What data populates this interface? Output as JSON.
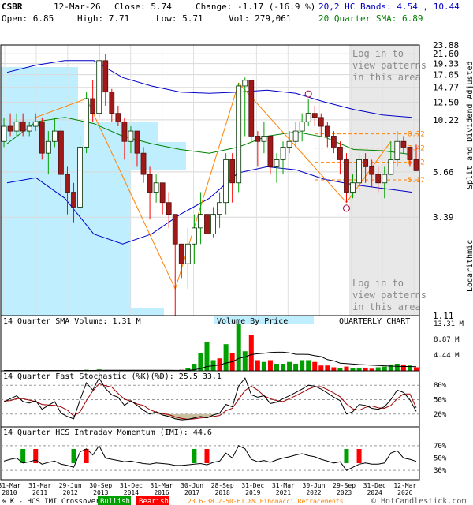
{
  "header": {
    "symbol": "CSBR",
    "date": "12-Mar-26",
    "close": "Close: 5.74",
    "change": "Change: -1.17 (-16.9 %)",
    "open": "Open: 6.85",
    "high": "High: 7.71",
    "low": "Low: 5.71",
    "vol": "Vol: 279,061",
    "bands": "20,2 HC Bands: 4.54 , 10.44",
    "sma": "20 Quarter SMA: 6.89"
  },
  "colors": {
    "up": "#00a000",
    "down": "#ff0000",
    "band": "#0000c8",
    "sma": "#008000",
    "vbp": "#bfefff",
    "stoch_k": "#000000",
    "stoch_d": "#a00000",
    "fib": "#ff8000",
    "shade": "#e8e8e8"
  },
  "price_panel": {
    "watermark": "Log in to\nview patterns\nin this area",
    "side_label_1": "Split and Dividend Adjusted",
    "side_label_2": "Logarithmic",
    "y_ticks": [
      "23.88",
      "21.60",
      "19.33",
      "17.05",
      "14.77",
      "12.50",
      "10.22",
      "5.66",
      "3.39",
      "1.11"
    ],
    "fib_labels": [
      "8.72",
      "7.42",
      "6.32",
      "5.17"
    ]
  },
  "volume_panel": {
    "title": "14 Quarter SMA Volume: 1.31 M",
    "vbp_label": "Volume By Price",
    "chart_label": "QUARTERLY CHART",
    "y_ticks": [
      "13.31 M",
      "8.87 M",
      "4.44 M"
    ]
  },
  "stoch_panel": {
    "title": "14 Quarter Fast Stochastic (%K)(%D): 25.5  33.1",
    "y_ticks": [
      "80%",
      "50%",
      "20%"
    ]
  },
  "imi_panel": {
    "title": "14 Quarter HCS Intraday Momentum (IMI): 44.6",
    "y_ticks": [
      "70%",
      "50%",
      "30%"
    ]
  },
  "x_labels": [
    [
      "31-Mar",
      "2010"
    ],
    [
      "31-Mar",
      "2011"
    ],
    [
      "29-Jun",
      "2012"
    ],
    [
      "30-Sep",
      "2013"
    ],
    [
      "31-Dec",
      "2014"
    ],
    [
      "31-Mar",
      "2016"
    ],
    [
      "30-Jun",
      "2017"
    ],
    [
      "28-Sep",
      "2018"
    ],
    [
      "31-Dec",
      "2019"
    ],
    [
      "31-Mar",
      "2021"
    ],
    [
      "30-Jun",
      "2022"
    ],
    [
      "29-Sep",
      "2023"
    ],
    [
      "31-Dec",
      "2024"
    ],
    [
      "12-Mar",
      "2026"
    ]
  ],
  "footer": {
    "legend_prefix": "% K - HCS IMI Crossover,",
    "bullish": "Bullish",
    "bearish": "Bearish",
    "fib": "23.6-38.2-50-61.8% Fibonacci Retracements",
    "copyright": "© HotCandlestick.com"
  },
  "chart_data": {
    "type": "candlestick",
    "y_scale": "log",
    "ylim": [
      1.11,
      23.88
    ],
    "candles": [
      [
        8.0,
        9.5,
        10.5,
        7.5
      ],
      [
        9.5,
        9.0,
        11.0,
        8.5
      ],
      [
        9.0,
        10.0,
        11.0,
        8.5
      ],
      [
        10.0,
        9.0,
        11.0,
        8.5
      ],
      [
        9.0,
        9.5,
        10.0,
        8.5
      ],
      [
        9.5,
        10.0,
        11.0,
        9.0
      ],
      [
        10.0,
        7.0,
        10.5,
        6.5
      ],
      [
        7.0,
        8.0,
        9.0,
        5.5
      ],
      [
        8.0,
        9.0,
        10.5,
        7.5
      ],
      [
        9.0,
        5.5,
        9.5,
        4.5
      ],
      [
        5.5,
        4.5,
        6.0,
        3.5
      ],
      [
        4.5,
        3.8,
        5.0,
        3.2
      ],
      [
        3.8,
        7.5,
        8.5,
        3.5
      ],
      [
        7.5,
        13.0,
        14.0,
        7.0
      ],
      [
        13.0,
        11.0,
        16.0,
        10.0
      ],
      [
        11.0,
        20.0,
        23.8,
        10.5
      ],
      [
        20.0,
        14.0,
        21.6,
        12.0
      ],
      [
        14.0,
        11.0,
        14.5,
        10.0
      ],
      [
        11.0,
        10.0,
        12.0,
        9.5
      ],
      [
        10.0,
        8.0,
        10.5,
        6.5
      ],
      [
        8.0,
        9.0,
        9.5,
        7.0
      ],
      [
        9.0,
        7.0,
        9.0,
        6.0
      ],
      [
        7.0,
        5.5,
        7.5,
        5.0
      ],
      [
        5.5,
        4.5,
        6.0,
        3.3
      ],
      [
        4.5,
        5.0,
        5.5,
        4.0
      ],
      [
        5.0,
        4.0,
        5.0,
        3.5
      ],
      [
        4.0,
        3.5,
        4.5,
        3.0
      ],
      [
        3.5,
        2.5,
        3.5,
        1.11
      ],
      [
        2.5,
        2.0,
        2.5,
        1.7
      ],
      [
        2.0,
        2.5,
        3.0,
        1.5
      ],
      [
        2.5,
        3.0,
        3.5,
        2.0
      ],
      [
        3.0,
        3.5,
        4.5,
        2.5
      ],
      [
        3.5,
        2.8,
        3.5,
        2.5
      ],
      [
        2.8,
        3.5,
        3.8,
        2.7
      ],
      [
        3.5,
        4.0,
        4.5,
        3.0
      ],
      [
        4.0,
        6.5,
        7.0,
        3.5
      ],
      [
        6.5,
        5.0,
        7.0,
        4.0
      ],
      [
        5.0,
        15.0,
        15.5,
        4.5
      ],
      [
        15.0,
        16.0,
        16.5,
        8.5
      ],
      [
        16.0,
        8.5,
        16.0,
        8.0
      ],
      [
        8.5,
        8.0,
        9.0,
        6.0
      ],
      [
        8.0,
        8.5,
        10.0,
        7.0
      ],
      [
        8.5,
        6.0,
        8.5,
        5.5
      ],
      [
        6.0,
        6.5,
        7.0,
        5.0
      ],
      [
        6.5,
        7.5,
        8.0,
        5.5
      ],
      [
        7.5,
        8.0,
        9.0,
        7.0
      ],
      [
        8.0,
        9.0,
        10.0,
        7.5
      ],
      [
        9.0,
        10.0,
        11.0,
        8.0
      ],
      [
        10.0,
        11.0,
        13.0,
        9.5
      ],
      [
        11.0,
        10.5,
        12.0,
        9.5
      ],
      [
        10.5,
        9.5,
        11.0,
        8.5
      ],
      [
        9.5,
        8.5,
        10.0,
        7.5
      ],
      [
        8.5,
        7.5,
        9.0,
        7.0
      ],
      [
        7.5,
        6.5,
        8.0,
        5.5
      ],
      [
        6.5,
        4.5,
        7.0,
        4.0
      ],
      [
        4.5,
        5.0,
        5.5,
        4.2
      ],
      [
        5.0,
        6.5,
        7.0,
        4.5
      ],
      [
        6.5,
        6.0,
        7.0,
        5.0
      ],
      [
        6.0,
        5.5,
        6.5,
        4.8
      ],
      [
        5.5,
        5.0,
        6.0,
        4.5
      ],
      [
        5.0,
        5.5,
        6.0,
        4.2
      ],
      [
        5.5,
        6.5,
        8.0,
        5.5
      ],
      [
        6.5,
        8.0,
        9.0,
        6.0
      ],
      [
        8.0,
        7.5,
        8.5,
        7.0
      ],
      [
        7.5,
        6.5,
        7.5,
        6.0
      ],
      [
        6.5,
        5.74,
        7.71,
        5.71
      ]
    ],
    "bands": {
      "upper": [
        17.5,
        19.0,
        20.0,
        20.0,
        16.5,
        15.0,
        14.0,
        13.8,
        14.0,
        14.3,
        13.8,
        12.5,
        11.5,
        10.8,
        10.5
      ],
      "sma": [
        7.8,
        10.0,
        10.5,
        9.8,
        8.5,
        7.8,
        7.3,
        7.0,
        7.5,
        8.5,
        8.9,
        8.4,
        7.3,
        7.2,
        6.9
      ],
      "lower": [
        5.0,
        5.3,
        4.2,
        2.8,
        2.5,
        2.8,
        3.5,
        4.2,
        5.6,
        6.0,
        5.8,
        5.2,
        4.9,
        4.7,
        4.5
      ]
    },
    "fib_levels": [
      8.72,
      7.42,
      6.32,
      5.17
    ],
    "volume": [
      [
        0.1,
        1
      ],
      [
        0.1,
        0
      ],
      [
        0.1,
        1
      ],
      [
        0.1,
        0
      ],
      [
        0.1,
        1
      ],
      [
        0.1,
        0
      ],
      [
        0.1,
        0
      ],
      [
        0.1,
        1
      ],
      [
        0.1,
        0
      ],
      [
        0.1,
        0
      ],
      [
        0.1,
        0
      ],
      [
        0.1,
        0
      ],
      [
        0.1,
        1
      ],
      [
        0.3,
        1
      ],
      [
        0.2,
        0
      ],
      [
        0.4,
        1
      ],
      [
        0.2,
        0
      ],
      [
        0.1,
        0
      ],
      [
        0.1,
        0
      ],
      [
        0.1,
        0
      ],
      [
        0.1,
        1
      ],
      [
        0.1,
        0
      ],
      [
        0.1,
        0
      ],
      [
        0.1,
        0
      ],
      [
        0.1,
        1
      ],
      [
        0.1,
        0
      ],
      [
        0.1,
        0
      ],
      [
        0.1,
        0
      ],
      [
        0.3,
        0
      ],
      [
        0.8,
        1
      ],
      [
        2.0,
        1
      ],
      [
        5.0,
        1
      ],
      [
        8.0,
        1
      ],
      [
        3.0,
        1
      ],
      [
        3.5,
        0
      ],
      [
        7.5,
        1
      ],
      [
        5.0,
        0
      ],
      [
        13.31,
        1
      ],
      [
        5.5,
        1
      ],
      [
        10.0,
        0
      ],
      [
        3.0,
        0
      ],
      [
        2.5,
        1
      ],
      [
        3.0,
        0
      ],
      [
        2.0,
        1
      ],
      [
        2.0,
        1
      ],
      [
        2.5,
        1
      ],
      [
        2.0,
        1
      ],
      [
        3.0,
        1
      ],
      [
        3.0,
        1
      ],
      [
        2.5,
        0
      ],
      [
        1.5,
        0
      ],
      [
        1.5,
        0
      ],
      [
        1.0,
        0
      ],
      [
        0.8,
        1
      ],
      [
        1.2,
        0
      ],
      [
        0.8,
        1
      ],
      [
        0.9,
        1
      ],
      [
        0.9,
        0
      ],
      [
        0.6,
        0
      ],
      [
        1.0,
        1
      ],
      [
        1.2,
        1
      ],
      [
        1.8,
        1
      ],
      [
        2.0,
        1
      ],
      [
        1.8,
        0
      ],
      [
        1.5,
        1
      ],
      [
        1.0,
        0
      ]
    ],
    "stoch_k": [
      45,
      52,
      58,
      46,
      43,
      48,
      30,
      38,
      46,
      22,
      15,
      10,
      50,
      85,
      70,
      95,
      73,
      60,
      55,
      38,
      48,
      38,
      28,
      20,
      25,
      18,
      15,
      10,
      8,
      9,
      12,
      15,
      12,
      18,
      22,
      40,
      35,
      78,
      95,
      60,
      55,
      58,
      42,
      45,
      52,
      58,
      65,
      72,
      80,
      78,
      72,
      64,
      55,
      48,
      20,
      25,
      40,
      38,
      32,
      30,
      35,
      50,
      70,
      65,
      50,
      25.5
    ],
    "stoch_d": [
      47,
      48,
      52,
      52,
      49,
      46,
      40,
      39,
      38,
      35,
      28,
      16,
      25,
      48,
      68,
      83,
      79,
      76,
      63,
      51,
      47,
      41,
      38,
      29,
      24,
      21,
      19,
      14,
      11,
      9,
      10,
      12,
      13,
      15,
      17,
      27,
      32,
      51,
      69,
      78,
      70,
      58,
      52,
      48,
      46,
      52,
      58,
      65,
      72,
      77,
      77,
      71,
      64,
      56,
      41,
      31,
      28,
      34,
      37,
      33,
      32,
      38,
      52,
      62,
      62,
      33.1
    ],
    "imi": [
      45,
      48,
      50,
      42,
      44,
      47,
      40,
      43,
      45,
      40,
      38,
      35,
      60,
      65,
      55,
      70,
      50,
      48,
      46,
      44,
      45,
      43,
      41,
      40,
      42,
      41,
      40,
      38,
      38,
      39,
      40,
      41,
      39,
      43,
      45,
      58,
      50,
      70,
      65,
      48,
      44,
      46,
      43,
      47,
      50,
      52,
      55,
      57,
      54,
      52,
      48,
      45,
      42,
      44,
      30,
      35,
      40,
      42,
      40,
      40,
      42,
      58,
      62,
      50,
      48,
      44.6
    ],
    "imi_cross": [
      [
        3,
        1
      ],
      [
        5,
        0
      ],
      [
        11,
        1
      ],
      [
        13,
        0
      ],
      [
        30,
        1
      ],
      [
        32,
        0
      ],
      [
        54,
        1
      ],
      [
        56,
        0
      ]
    ]
  }
}
